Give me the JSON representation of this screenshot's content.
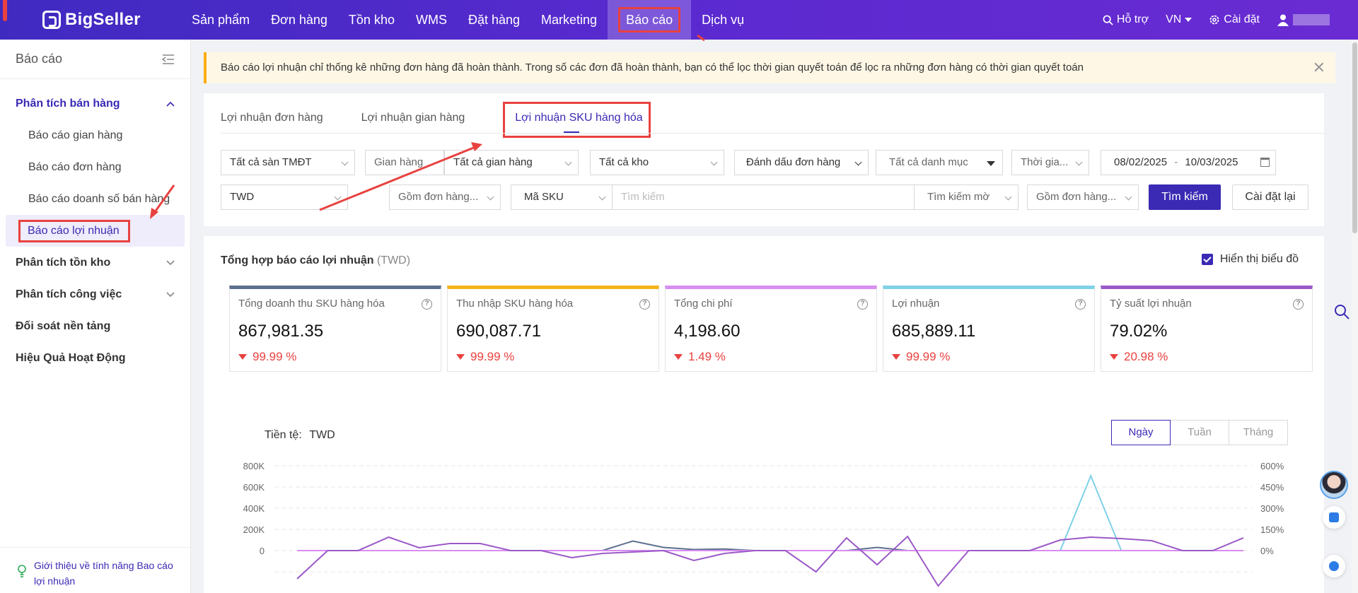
{
  "app": {
    "logo": "BigSeller",
    "nav": [
      "Sản phẩm",
      "Đơn hàng",
      "Tồn kho",
      "WMS",
      "Đặt hàng",
      "Marketing",
      "Báo cáo",
      "Dịch vụ"
    ],
    "support": "Hỗ trợ",
    "lang": "VN",
    "settings": "Cài đặt"
  },
  "sidebar": {
    "title": "Báo cáo",
    "groups": [
      {
        "label": "Phân tích bán hàng",
        "items": [
          "Báo cáo gian hàng",
          "Báo cáo đơn hàng",
          "Báo cáo doanh số bán hàng",
          "Báo cáo lợi nhuận"
        ]
      },
      {
        "label": "Phân tích tồn kho"
      },
      {
        "label": "Phân tích công việc"
      },
      {
        "label": "Đối soát nền tảng"
      },
      {
        "label": "Hiệu Quả Hoạt Động"
      }
    ],
    "footer": "Giới thiệu về tính năng Bao cáo lợi nhuận"
  },
  "alert": "Báo cáo lợi nhuận chỉ thống kê những đơn hàng đã hoàn thành. Trong số các đơn đã hoàn thành, bạn có thể lọc thời gian quyết toán để lọc ra những đơn hàng có thời gian quyết toán",
  "tabs": [
    "Lợi nhuận đơn hàng",
    "Lợi nhuận gian hàng",
    "Lợi nhuận SKU hàng hóa"
  ],
  "filters": {
    "platform": "Tất cả sàn TMĐT",
    "store_label": "Gian hàng",
    "store": "Tất cả gian hàng",
    "warehouse": "Tất cả kho",
    "order_mark": "Đánh dấu đơn hàng",
    "category": "Tất cả danh mục",
    "time": "Thời gia...",
    "date_from": "08/02/2025",
    "date_sep": "-",
    "date_to": "10/03/2025",
    "currency": "TWD",
    "include_orders": "Gồm đơn hàng...",
    "sku_type": "Mã SKU",
    "search_placeholder": "Tìm kiếm",
    "fuzzy": "Tìm kiếm mờ",
    "include_orders2": "Gồm đơn hàng...",
    "search_btn": "Tìm kiếm",
    "reset_btn": "Cài đặt lại"
  },
  "summary": {
    "title": "Tổng hợp báo cáo lợi nhuận",
    "currency": "(TWD)",
    "show_chart": "Hiển thị biểu đồ",
    "kpis": [
      {
        "label": "Tổng doanh thu SKU hàng hóa",
        "value": "867,981.35",
        "delta": "99.99 %",
        "color": "#5d6f8e"
      },
      {
        "label": "Thu nhập SKU hàng hóa",
        "value": "690,087.71",
        "delta": "99.99 %",
        "color": "#f5b31a"
      },
      {
        "label": "Tổng chi phí",
        "value": "4,198.60",
        "delta": "1.49 %",
        "color": "#d88df0"
      },
      {
        "label": "Lợi nhuận",
        "value": "685,889.11",
        "delta": "99.99 %",
        "color": "#7fd1e8"
      },
      {
        "label": "Tỷ suất lợi nhuận",
        "value": "79.02%",
        "delta": "20.98 %",
        "color": "#9b59c8"
      }
    ]
  },
  "chart_area": {
    "currency_label": "Tiền tệ:",
    "currency": "TWD",
    "periods": [
      "Ngày",
      "Tuần",
      "Tháng"
    ],
    "selected_period": "Ngày"
  },
  "chart_data": {
    "type": "line",
    "y_left_ticks": [
      "800K",
      "600K",
      "400K",
      "200K",
      "0"
    ],
    "y_left_range": [
      -200000,
      800000
    ],
    "y_right_ticks": [
      "600%",
      "450%",
      "300%",
      "150%",
      "0%"
    ],
    "y_right_range": [
      -150,
      600
    ],
    "series": [
      {
        "color": "#5d6f8e",
        "axis": "left",
        "values": [
          0,
          0,
          0,
          0,
          0,
          0,
          0,
          0,
          0,
          0,
          0,
          90000,
          30000,
          10000,
          15000,
          0,
          0,
          0,
          0,
          30000,
          0,
          0,
          0,
          0,
          0,
          0,
          0,
          0,
          0,
          0,
          0,
          0
        ]
      },
      {
        "color": "#7fd1e8",
        "axis": "left",
        "values": [
          0,
          0,
          0,
          0,
          0,
          0,
          0,
          0,
          0,
          0,
          0,
          0,
          0,
          0,
          0,
          0,
          0,
          0,
          0,
          0,
          0,
          0,
          0,
          0,
          0,
          0,
          705000,
          0,
          0,
          0,
          0,
          0
        ]
      },
      {
        "color": "#d88df0",
        "axis": "left",
        "values": [
          0,
          0,
          0,
          0,
          0,
          0,
          0,
          0,
          0,
          0,
          0,
          0,
          0,
          0,
          0,
          0,
          0,
          0,
          0,
          0,
          0,
          0,
          0,
          0,
          0,
          0,
          0,
          0,
          0,
          0,
          0,
          0
        ]
      },
      {
        "color": "#9b59c8",
        "axis": "right",
        "values": [
          -200,
          0,
          0,
          95,
          20,
          50,
          50,
          0,
          0,
          -50,
          -20,
          -10,
          0,
          -70,
          -20,
          0,
          0,
          -150,
          90,
          -100,
          100,
          -250,
          0,
          0,
          0,
          75,
          95,
          85,
          70,
          0,
          0,
          90
        ]
      }
    ]
  }
}
